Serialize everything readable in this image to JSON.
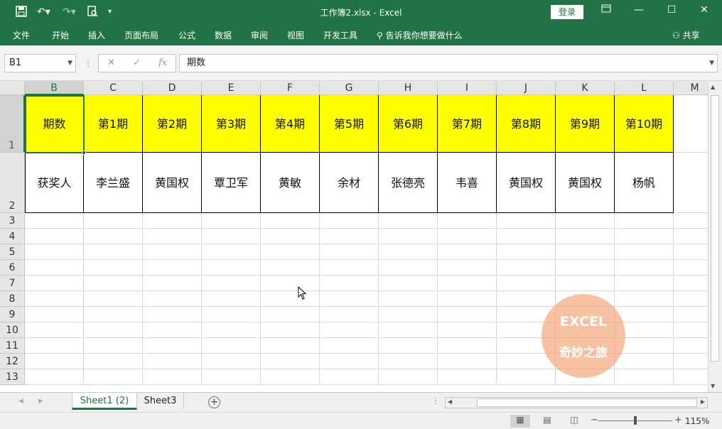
{
  "titlebar": {
    "title": "工作簿2.xlsx  -  Excel",
    "login_label": "登录",
    "qa_icons": [
      "save-icon",
      "undo-icon",
      "redo-icon",
      "print-preview-icon",
      "customize-icon"
    ],
    "accent": "#217346"
  },
  "ribbon": {
    "tabs": [
      "文件",
      "开始",
      "插入",
      "页面布局",
      "公式",
      "数据",
      "审阅",
      "视图",
      "开发工具"
    ],
    "tellme": "告诉我你想要做什么",
    "share": "共享"
  },
  "formula_bar": {
    "name_box": "B1",
    "cancel": "✕",
    "enter": "✓",
    "fx": "fx",
    "value": "期数"
  },
  "sheet": {
    "columns": [
      "B",
      "C",
      "D",
      "E",
      "F",
      "G",
      "H",
      "I",
      "J",
      "K",
      "L",
      "M"
    ],
    "rows": [
      "1",
      "2",
      "3",
      "4",
      "5",
      "6",
      "7",
      "8",
      "9",
      "10",
      "11",
      "12",
      "13"
    ],
    "selected_cell": "B1",
    "row1": [
      "期数",
      "第1期",
      "第2期",
      "第3期",
      "第4期",
      "第5期",
      "第6期",
      "第7期",
      "第8期",
      "第9期",
      "第10期"
    ],
    "row2": [
      "获奖人",
      "李兰盛",
      "黄国权",
      "覃卫军",
      "黄敏",
      "余材",
      "张德亮",
      "韦喜",
      "黄国权",
      "黄国权",
      "杨帆"
    ],
    "highlight_color": "#ffff00"
  },
  "watermark": {
    "line1": "EXCEL",
    "line2": "奇妙之旅"
  },
  "sheet_tabs": [
    {
      "label": "Sheet1 (2)",
      "active": true
    },
    {
      "label": "Sheet3",
      "active": false
    }
  ],
  "status": {
    "zoom": "115%"
  }
}
